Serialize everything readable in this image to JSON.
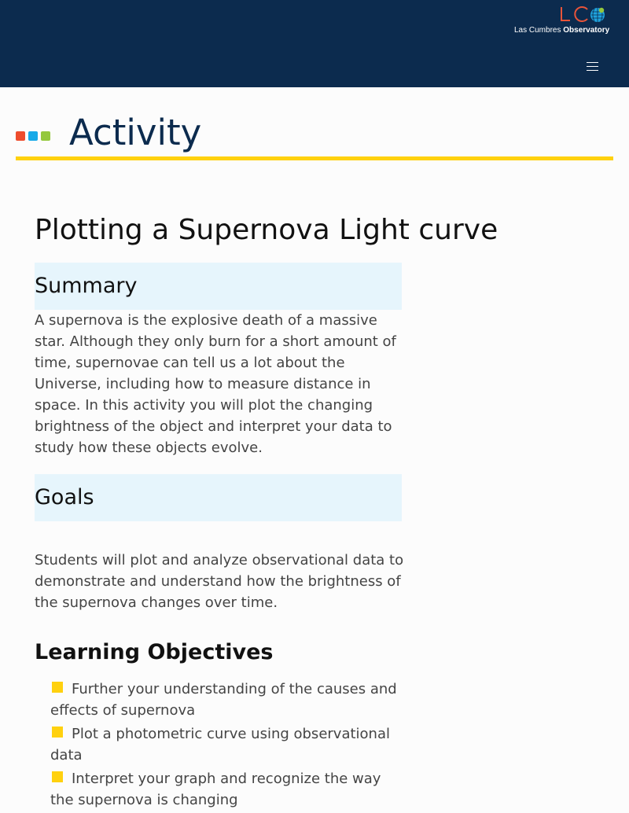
{
  "header": {
    "logo": {
      "mark": "LC",
      "name_light": "Las Cumbres",
      "name_bold": "Observatory"
    },
    "menu_icon": "hamburger-menu-icon",
    "colors": {
      "background": "#0c2b4e",
      "logo_red": "#e8543a",
      "logo_globe": "#1fa3dd"
    }
  },
  "banner": {
    "title": "Activity",
    "dots": [
      "#ee4d2d",
      "#16a9e8",
      "#94c83d"
    ],
    "underline_color": "#ffd10f"
  },
  "page_title": "Plotting a Supernova Light curve",
  "summary": {
    "heading": "Summary",
    "text": "A supernova is the explosive death of a massive star. Although they only burn for a short amount of time, supernovae can tell us a lot about the Universe, including how to measure distance in space. In this activity you will plot the changing brightness of the object and interpret your data to study how these objects evolve."
  },
  "goals": {
    "heading": "Goals",
    "text": "Students will plot and analyze observational data to demonstrate and understand how the brightness of the supernova changes over time."
  },
  "learning_objectives": {
    "heading": "Learning Objectives",
    "items": [
      "Further your understanding of the causes and effects of supernova",
      "Plot a photometric curve using observational data",
      "Interpret your graph and recognize the way the supernova is changing"
    ]
  }
}
